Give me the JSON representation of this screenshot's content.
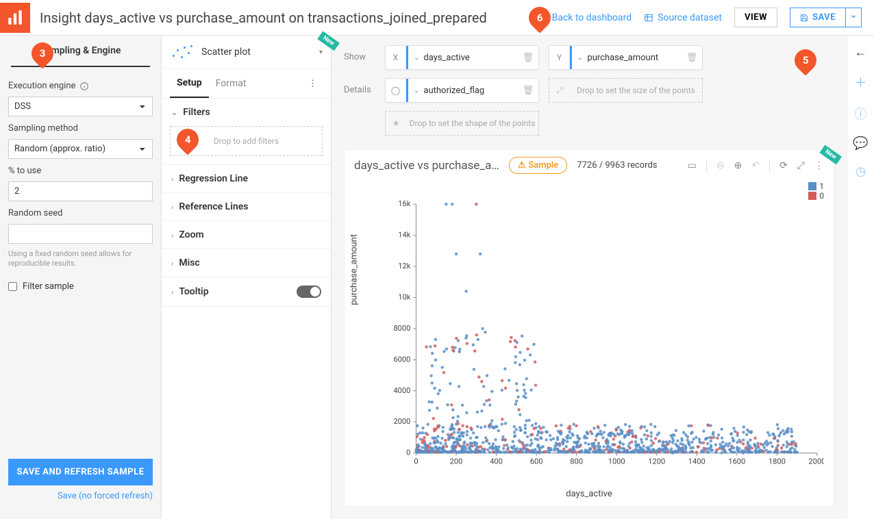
{
  "header": {
    "title": "Insight days_active vs purchase_amount on transactions_joined_prepared",
    "back": "Back to dashboard",
    "source": "Source dataset",
    "view": "VIEW",
    "save": "SAVE"
  },
  "leftPanel": {
    "tab": "Sampling & Engine",
    "execEngineLabel": "Execution engine",
    "execEngineValue": "DSS",
    "samplingMethodLabel": "Sampling method",
    "samplingMethodValue": "Random (approx. ratio)",
    "pctLabel": "% to use",
    "pctValue": "2",
    "seedLabel": "Random seed",
    "seedValue": "",
    "seedHint": "Using a fixed random seed allows for reproducible results.",
    "filterSample": "Filter sample",
    "refreshBtn": "SAVE AND REFRESH SAMPLE",
    "saveLink": "Save (no forced refresh)"
  },
  "midPanel": {
    "chartType": "Scatter plot",
    "newBadge": "New",
    "tabs": {
      "setup": "Setup",
      "format": "Format"
    },
    "filters": "Filters",
    "filtersDrop": "Drop to add filters",
    "regLine": "Regression Line",
    "refLines": "Reference Lines",
    "zoom": "Zoom",
    "misc": "Misc",
    "tooltip": "Tooltip"
  },
  "config": {
    "showLabel": "Show",
    "detailsLabel": "Details",
    "x": {
      "label": "X",
      "value": "days_active"
    },
    "y": {
      "label": "Y",
      "value": "purchase_amount"
    },
    "color": {
      "value": "authorized_flag"
    },
    "sizeDrop": "Drop to set the size of the points",
    "shapeDrop": "Drop to set the shape of the points"
  },
  "chart": {
    "title": "days_active vs purchase_a…",
    "sample": "Sample",
    "records": "7726 / 9963 records",
    "newBadge": "New",
    "legend": [
      {
        "label": "1",
        "color": "#5a8fc7"
      },
      {
        "label": "0",
        "color": "#d55b5b"
      }
    ]
  },
  "tags": {
    "3": "3",
    "4": "4",
    "5": "5",
    "6": "6"
  },
  "chart_data": {
    "type": "scatter",
    "title": "days_active vs purchase_amount",
    "xlabel": "days_active",
    "ylabel": "purchase_amount",
    "xlim": [
      0,
      2000
    ],
    "ylim": [
      0,
      16000
    ],
    "xticks": [
      0,
      200,
      400,
      600,
      800,
      1000,
      1200,
      1400,
      1600,
      1800,
      2000
    ],
    "yticks": [
      0,
      2000,
      4000,
      6000,
      8000,
      10000,
      12000,
      14000,
      16000
    ],
    "yticklabels": [
      "0",
      "2000",
      "4000",
      "6000",
      "8000",
      "10k",
      "12k",
      "14k",
      "16k"
    ],
    "series": [
      {
        "name": "1",
        "color": "#5a8fc7"
      },
      {
        "name": "0",
        "color": "#d55b5b"
      }
    ],
    "note": "Dense scatter ~7726 points; majority concentrated between x 0–600 and y 0–2000; a handful of blue outliers near y≈16000 at x≈150–300 and one red outlier at x≈300 y≈16000; cluster of blue/red up to y≈8000 around x 100–500; long sparse tail out to x≈1900 y≈0–1000."
  }
}
